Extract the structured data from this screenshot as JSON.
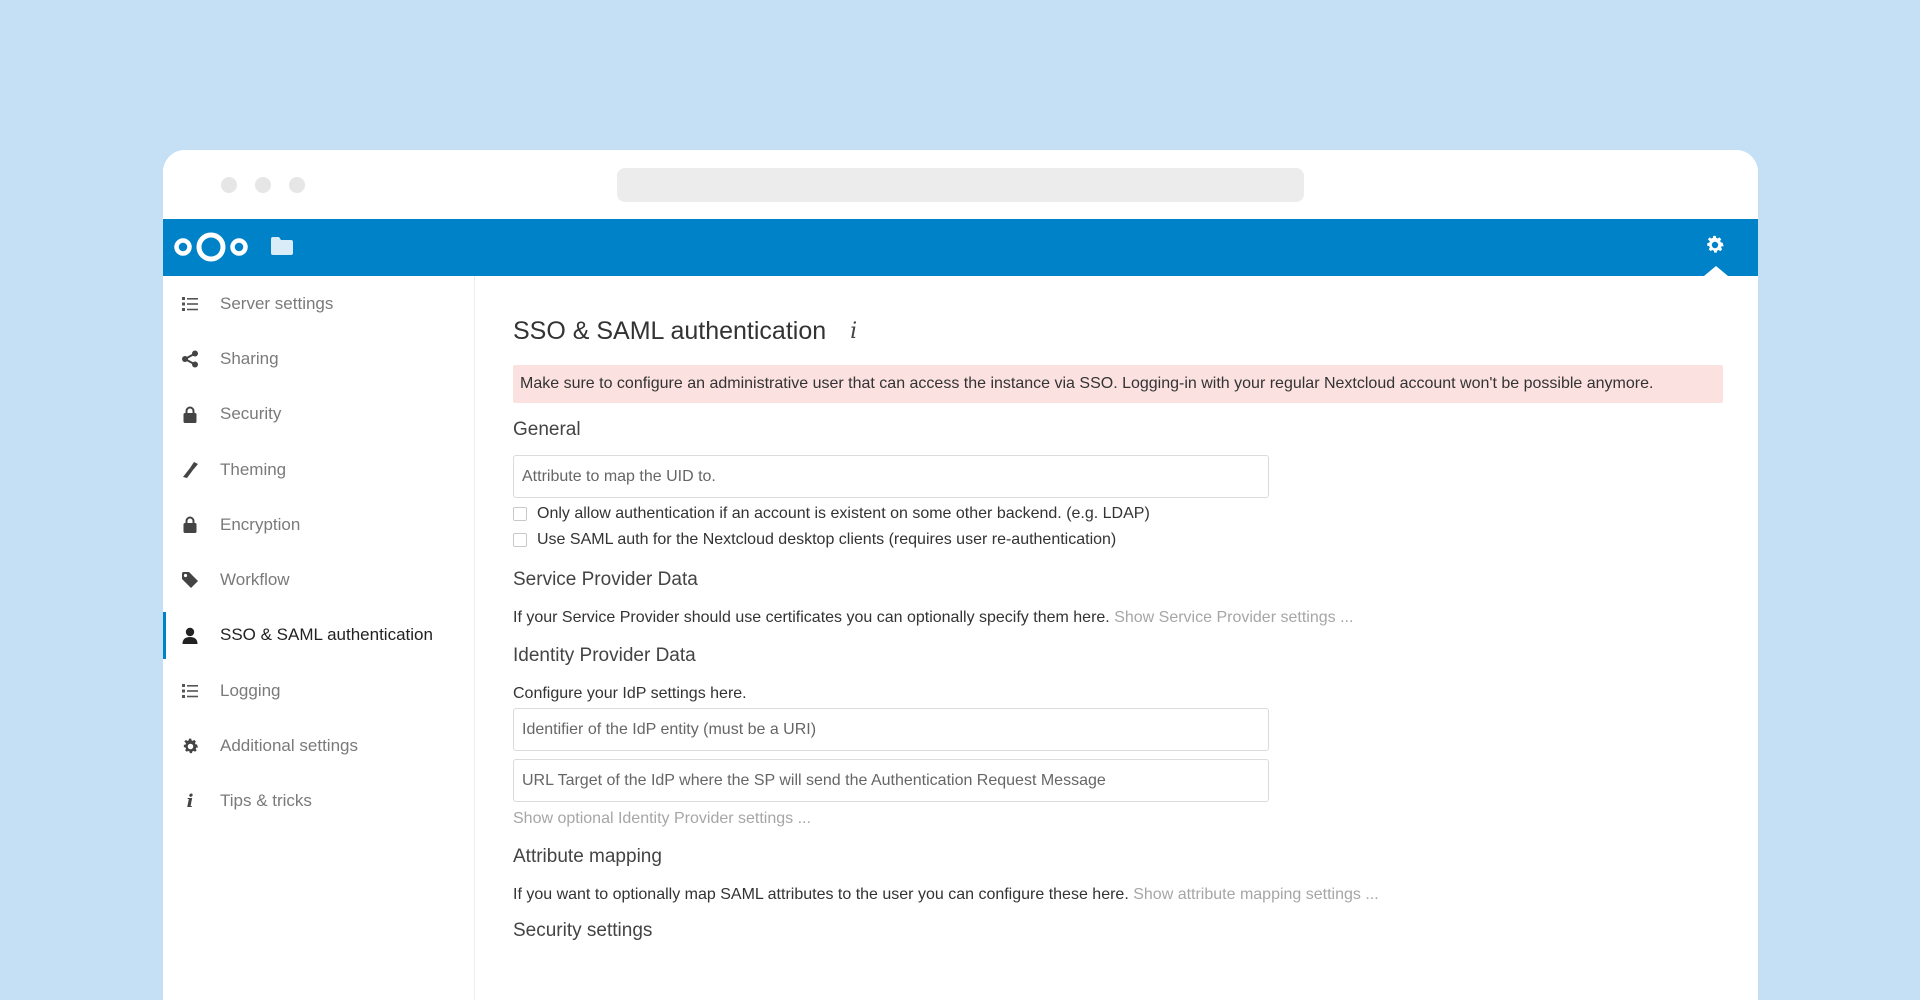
{
  "colors": {
    "background": "#c5e0f5",
    "header": "#0082c9",
    "warning_bg": "#fce1e1",
    "active_indicator": "#0082c9",
    "link": "#a6a6a6"
  },
  "header": {
    "logo": "nextcloud-logo",
    "apps": [
      "files-icon"
    ],
    "settings_icon": "gear-icon"
  },
  "sidebar": {
    "items": [
      {
        "label": "Server settings",
        "icon": "list-icon",
        "active": false
      },
      {
        "label": "Sharing",
        "icon": "share-icon",
        "active": false
      },
      {
        "label": "Security",
        "icon": "lock-icon",
        "active": false
      },
      {
        "label": "Theming",
        "icon": "brush-icon",
        "active": false
      },
      {
        "label": "Encryption",
        "icon": "lock-icon",
        "active": false
      },
      {
        "label": "Workflow",
        "icon": "tag-icon",
        "active": false
      },
      {
        "label": "SSO & SAML authentication",
        "icon": "user-icon",
        "active": true
      },
      {
        "label": "Logging",
        "icon": "list-icon",
        "active": false
      },
      {
        "label": "Additional settings",
        "icon": "gear-icon",
        "active": false
      },
      {
        "label": "Tips & tricks",
        "icon": "info-icon",
        "active": false
      }
    ]
  },
  "main": {
    "title": "SSO & SAML authentication",
    "info_icon": "info-icon",
    "warning": "Make sure to configure an administrative user that can access the instance via SSO. Logging-in with your regular Nextcloud account won't be possible anymore.",
    "general": {
      "heading": "General",
      "uid_placeholder": "Attribute to map the UID to.",
      "checkbox_1": "Only allow authentication if an account is existent on some other backend. (e.g. LDAP)",
      "checkbox_2": "Use SAML auth for the Nextcloud desktop clients (requires user re-authentication)"
    },
    "sp": {
      "heading": "Service Provider Data",
      "text": "If your Service Provider should use certificates you can optionally specify them here.",
      "link": "Show Service Provider settings ..."
    },
    "idp": {
      "heading": "Identity Provider Data",
      "text": "Configure your IdP settings here.",
      "entity_placeholder": "Identifier of the IdP entity (must be a URI)",
      "url_placeholder": "URL Target of the IdP where the SP will send the Authentication Request Message",
      "link": "Show optional Identity Provider settings ..."
    },
    "attr": {
      "heading": "Attribute mapping",
      "text": "If you want to optionally map SAML attributes to the user you can configure these here.",
      "link": "Show attribute mapping settings ..."
    },
    "security": {
      "heading": "Security settings"
    }
  }
}
